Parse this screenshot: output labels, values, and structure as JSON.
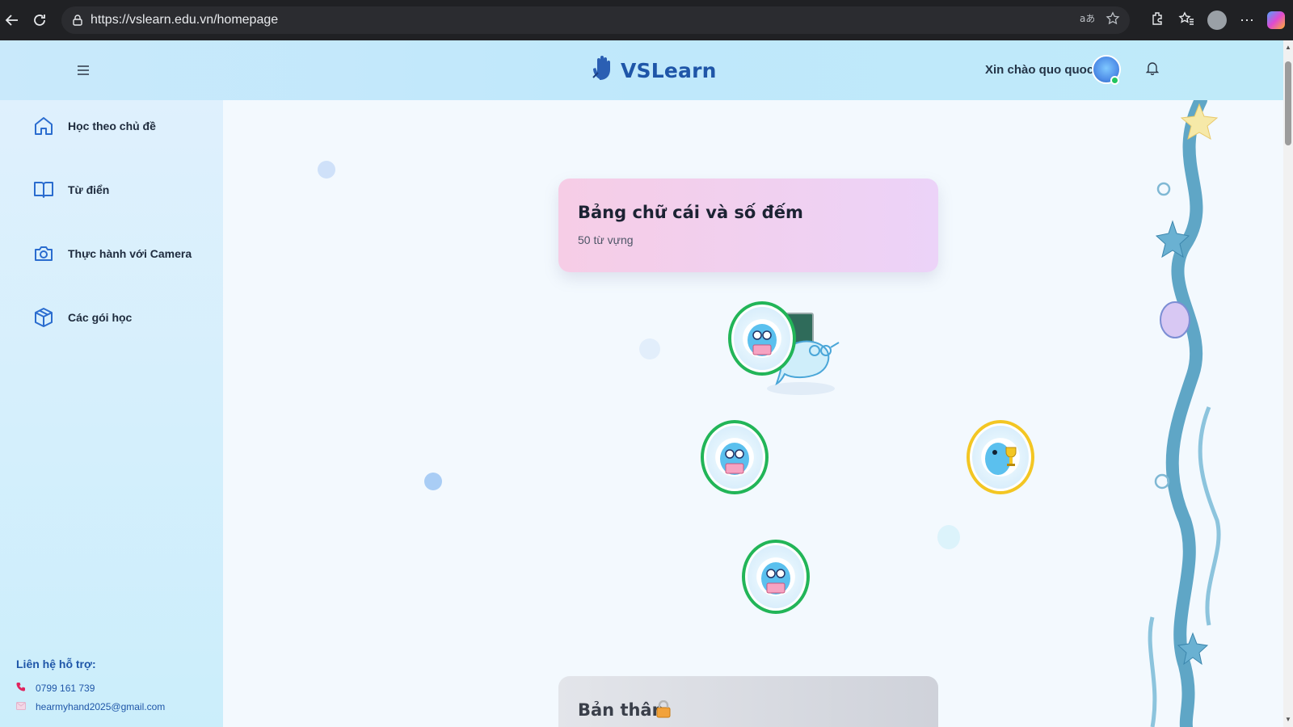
{
  "browser": {
    "url": "https://vslearn.edu.vn/homepage"
  },
  "header": {
    "logo_text": "VSLearn",
    "greeting": "Xin chào quo quoc"
  },
  "sidebar": {
    "items": [
      {
        "label": "Học theo chủ đề",
        "icon": "home-icon"
      },
      {
        "label": "Từ điển",
        "icon": "book-icon"
      },
      {
        "label": "Thực hành với Camera",
        "icon": "camera-icon"
      },
      {
        "label": "Các gói học",
        "icon": "package-icon"
      }
    ],
    "support": {
      "title": "Liên hệ hỗ trợ:",
      "phone": "0799 161 739",
      "email": "hearmyhand2025@gmail.com"
    }
  },
  "main": {
    "unit_card": {
      "title": "Bảng chữ cái và số đếm",
      "subtitle": "50 từ vựng"
    },
    "locked_card": {
      "title": "Bản thân",
      "lock_emoji": "🔒"
    },
    "lesson_nodes": [
      {
        "status": "completed",
        "color": "#22b558",
        "icon": "mascot-reading-icon"
      },
      {
        "status": "completed",
        "color": "#22b558",
        "icon": "mascot-reading-icon"
      },
      {
        "status": "trophy",
        "color": "#f3c623",
        "icon": "mascot-trophy-icon"
      },
      {
        "status": "completed",
        "color": "#22b558",
        "icon": "mascot-reading-icon"
      }
    ]
  },
  "colors": {
    "brand": "#1f56a8",
    "success": "#22b558",
    "gold": "#f3c623"
  }
}
